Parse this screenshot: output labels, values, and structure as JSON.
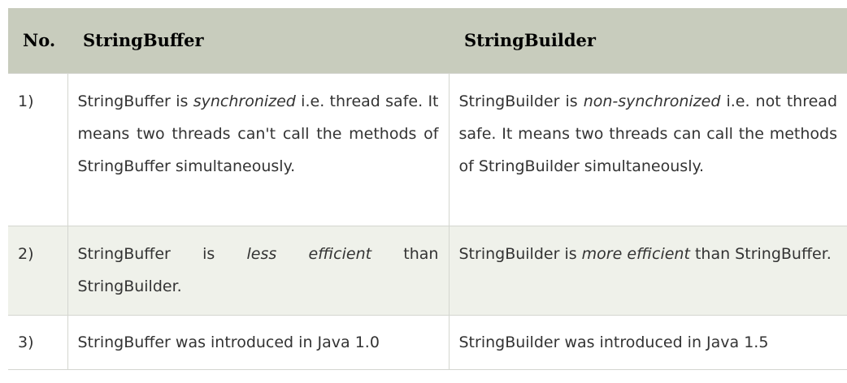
{
  "table": {
    "headers": {
      "no": "No.",
      "stringbuffer": "StringBuffer",
      "stringbuilder": "StringBuilder"
    },
    "rows": [
      {
        "no": "1)",
        "stringbuffer": {
          "before": "StringBuffer is ",
          "emphasis": "synchronized",
          "after": " i.e. thread safe. It means two threads can't call the methods of StringBuffer simultaneously."
        },
        "stringbuilder": {
          "before": "StringBuilder is ",
          "emphasis": "non-synchronized",
          "after": " i.e. not thread safe. It means two threads can call the methods of StringBuilder simultaneously."
        }
      },
      {
        "no": "2)",
        "stringbuffer": {
          "before": "StringBuffer is ",
          "emphasis": "less efficient",
          "after": " than StringBuilder."
        },
        "stringbuilder": {
          "before": "StringBuilder is ",
          "emphasis": "more efficient",
          "after": " than StringBuffer."
        }
      },
      {
        "no": "3)",
        "stringbuffer": {
          "text": "StringBuffer was introduced in Java 1.0"
        },
        "stringbuilder": {
          "text": "StringBuilder was introduced in Java 1.5"
        }
      }
    ]
  }
}
